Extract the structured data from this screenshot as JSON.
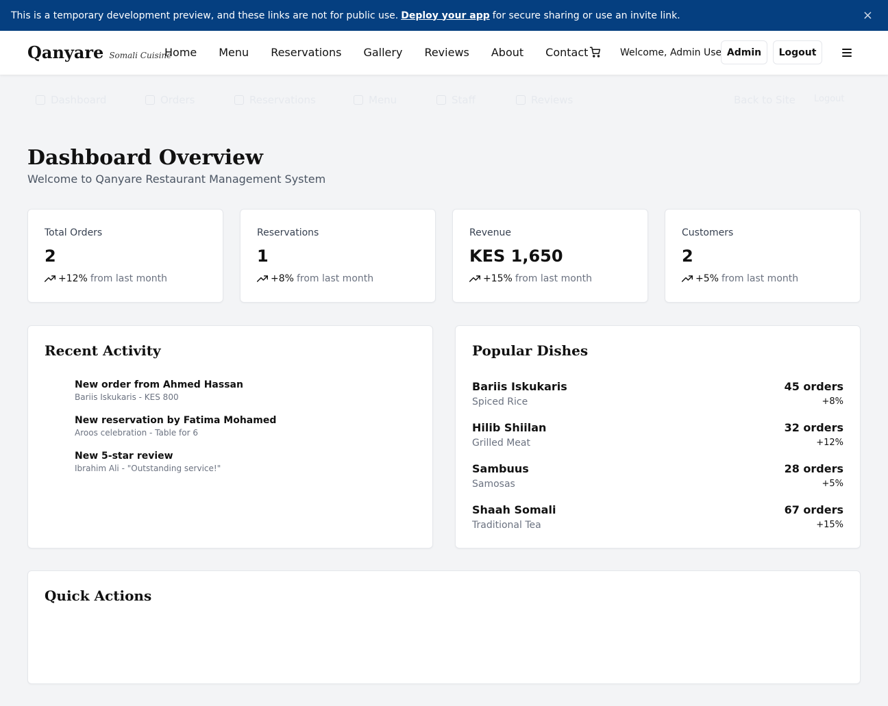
{
  "banner": {
    "text_before": "This is a temporary development preview, and these links are not for public use.",
    "link": "Deploy your app",
    "text_after": "for secure sharing or use an invite link.",
    "close": "×"
  },
  "header": {
    "brand": "Qanyare",
    "tagline": "Somali Cuisine",
    "nav": [
      "Home",
      "Menu",
      "Reservations",
      "Gallery",
      "Reviews",
      "About",
      "Contact"
    ],
    "welcome": "Welcome, Admin User",
    "admin": "Admin",
    "logout": "Logout"
  },
  "subnav": {
    "items": [
      "Dashboard",
      "Orders",
      "Reservations",
      "Menu",
      "Staff",
      "Reviews"
    ],
    "back": "Back to Site",
    "logout": "Logout"
  },
  "page": {
    "title": "Dashboard Overview",
    "subtitle": "Welcome to Qanyare Restaurant Management System"
  },
  "stats": [
    {
      "label": "Total Orders",
      "value": "2",
      "change": "+12%",
      "suffix": "from last month"
    },
    {
      "label": "Reservations",
      "value": "1",
      "change": "+8%",
      "suffix": "from last month"
    },
    {
      "label": "Revenue",
      "value": "KES 1,650",
      "change": "+15%",
      "suffix": "from last month"
    },
    {
      "label": "Customers",
      "value": "2",
      "change": "+5%",
      "suffix": "from last month"
    }
  ],
  "recent_activity": {
    "title": "Recent Activity",
    "items": [
      {
        "title": "New order from Ahmed Hassan",
        "detail": "Bariis Iskukaris - KES 800"
      },
      {
        "title": "New reservation by Fatima Mohamed",
        "detail": "Aroos celebration - Table for 6"
      },
      {
        "title": "New 5-star review",
        "detail": "Ibrahim Ali - \"Outstanding service!\""
      }
    ]
  },
  "popular_dishes": {
    "title": "Popular Dishes",
    "items": [
      {
        "name": "Bariis Iskukaris",
        "category": "Spiced Rice",
        "orders": "45 orders",
        "change": "+8%"
      },
      {
        "name": "Hilib Shiilan",
        "category": "Grilled Meat",
        "orders": "32 orders",
        "change": "+12%"
      },
      {
        "name": "Sambuus",
        "category": "Samosas",
        "orders": "28 orders",
        "change": "+5%"
      },
      {
        "name": "Shaah Somali",
        "category": "Traditional Tea",
        "orders": "67 orders",
        "change": "+15%"
      }
    ]
  },
  "quick_actions": {
    "title": "Quick Actions"
  },
  "icons": {
    "cart": "cart-icon",
    "menu": "hamburger-icon",
    "trend": "trending-up-icon",
    "close": "close-icon"
  },
  "colors": {
    "banner_bg": "#053f80",
    "page_bg": "#f3f4f6",
    "card_bg": "#ffffff"
  }
}
